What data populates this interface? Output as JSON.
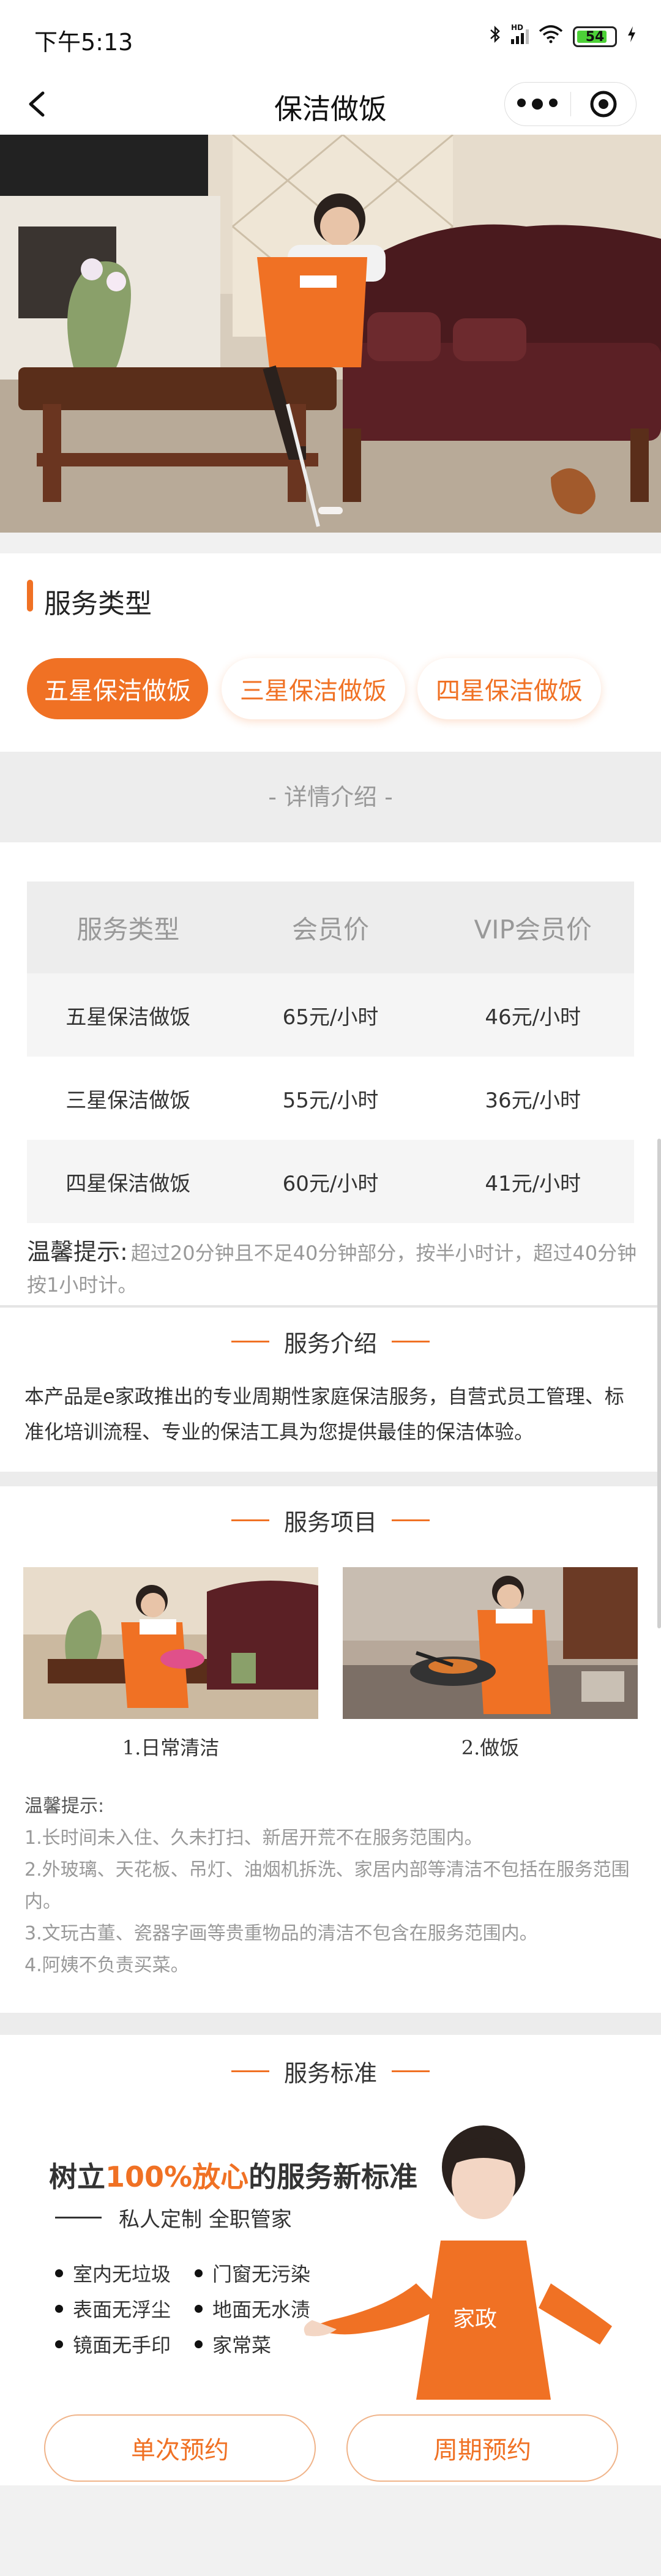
{
  "status_bar": {
    "time": "下午5:13",
    "battery": "54",
    "hd_label": "HD"
  },
  "navbar": {
    "title": "保洁做饭"
  },
  "service_type": {
    "title": "服务类型",
    "options": [
      {
        "label": "五星保洁做饭",
        "selected": true
      },
      {
        "label": "三星保洁做饭",
        "selected": false
      },
      {
        "label": "四星保洁做饭",
        "selected": false
      }
    ]
  },
  "detail_heading": "- 详情介绍 -",
  "price_table": {
    "headers": [
      "服务类型",
      "会员价",
      "VIP会员价"
    ],
    "rows": [
      [
        "五星保洁做饭",
        "65元/小时",
        "46元/小时"
      ],
      [
        "三星保洁做饭",
        "55元/小时",
        "36元/小时"
      ],
      [
        "四星保洁做饭",
        "60元/小时",
        "41元/小时"
      ]
    ]
  },
  "tip": {
    "label": "温馨提示:",
    "text": "超过20分钟且不足40分钟部分，按半小时计，超过40分钟按1小时计。"
  },
  "intro": {
    "title": "服务介绍",
    "text": "本产品是e家政推出的专业周期性家庭保洁服务，自营式员工管理、标准化培训流程、专业的保洁工具为您提供最佳的保洁体验。"
  },
  "items": {
    "title": "服务项目",
    "cards": [
      {
        "caption": "1.日常清洁"
      },
      {
        "caption": "2.做饭"
      }
    ],
    "tips_heading": "温馨提示:",
    "tips": [
      "1.长时间未入住、久未打扫、新居开荒不在服务范围内。",
      "2.外玻璃、天花板、吊灯、油烟机拆洗、家居内部等清洁不包括在服务范围内。",
      "3.文玩古董、瓷器字画等贵重物品的清洁不包含在服务范围内。",
      "4.阿姨不负责买菜。"
    ]
  },
  "standard": {
    "title": "服务标准",
    "headline_pre": "树立",
    "headline_hl": "100%放心",
    "headline_post": "的服务新标准",
    "subline": "私人定制  全职管家",
    "features": [
      "室内无垃圾",
      "门窗无污染",
      "表面无浮尘",
      "地面无水渍",
      "镜面无手印",
      "家常菜"
    ],
    "apron_text": "家政"
  },
  "buttons": {
    "single": "单次预约",
    "periodic": "周期预约"
  },
  "colors": {
    "accent": "#f07124",
    "muted": "#999999"
  }
}
